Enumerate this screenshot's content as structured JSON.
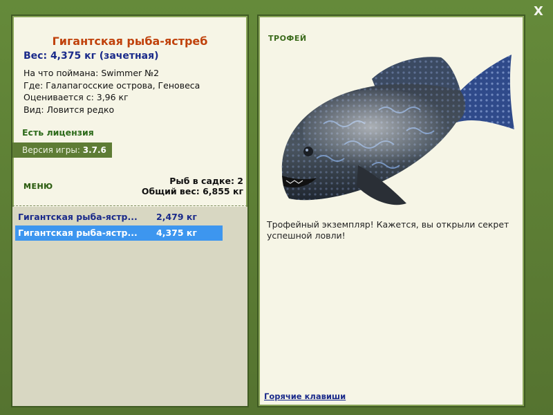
{
  "window": {
    "close_label": "X"
  },
  "left": {
    "fish_name": "Гигантская рыба-ястреб",
    "weight": "Вес: 4,375 кг (зачетная)",
    "caught_on": "На что поймана: Swimmer №2",
    "location": "Где: Галапагосские острова, Геновеса",
    "valued_from": "Оценивается с: 3,96 кг",
    "kind": "Вид: Ловится редко",
    "license": "Есть лицензия",
    "version_label": "Версия игры:",
    "version_value": "3.7.6",
    "menu_label": "МЕНЮ",
    "fish_count": "Рыб в садке: 2",
    "total_weight": "Общий вес: 6,855 кг",
    "catch_list": [
      {
        "name": "Гигантская рыба-ястр...",
        "weight": "2,479 кг"
      },
      {
        "name": "Гигантская рыба-ястр...",
        "weight": "4,375 кг"
      }
    ]
  },
  "right": {
    "trophy_label": "ТРОФЕЙ",
    "fish_image": "giant-hawkfish-icon",
    "description": "Трофейный экземпляр! Кажется, вы открыли секрет успешной ловли!",
    "hotkeys_link": "Горячие клавиши"
  },
  "colors": {
    "frame": "#5f8236",
    "panel": "#f6f5e6",
    "title": "#c0420c",
    "link": "#1a2a8a",
    "selection": "#3d96ef"
  }
}
